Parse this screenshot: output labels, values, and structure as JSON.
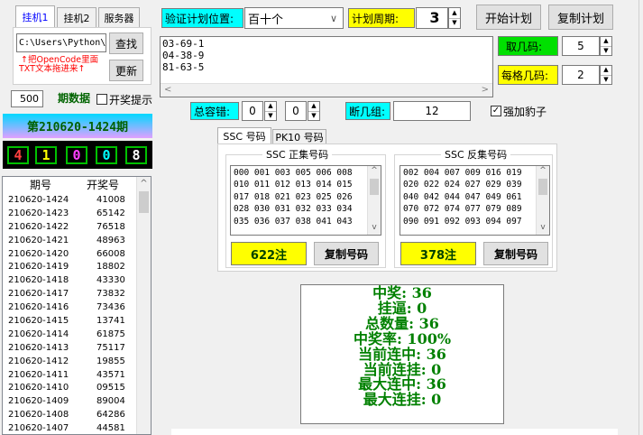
{
  "tabs": [
    {
      "label": "挂机1"
    },
    {
      "label": "挂机2"
    },
    {
      "label": "服务器"
    }
  ],
  "path_input": "C:\\Users\\Python\\D",
  "find_button": "查找",
  "hint_line1": "↑把OpenCode里面",
  "hint_line2": "TXT文本拖进来↑",
  "update_button": "更新",
  "period_count": "500",
  "period_label": "期数据",
  "lottery_hint_label": "开奖提示",
  "current_period": "第210620-1424期",
  "digits": [
    "4",
    "1",
    "0",
    "0",
    "8"
  ],
  "history": {
    "headers": [
      "期号",
      "开奖号"
    ],
    "rows": [
      [
        "210620-1424",
        "41008"
      ],
      [
        "210620-1423",
        "65142"
      ],
      [
        "210620-1422",
        "76518"
      ],
      [
        "210620-1421",
        "48963"
      ],
      [
        "210620-1420",
        "66008"
      ],
      [
        "210620-1419",
        "18802"
      ],
      [
        "210620-1418",
        "43330"
      ],
      [
        "210620-1417",
        "73832"
      ],
      [
        "210620-1416",
        "73436"
      ],
      [
        "210620-1415",
        "13741"
      ],
      [
        "210620-1414",
        "61875"
      ],
      [
        "210620-1413",
        "75117"
      ],
      [
        "210620-1412",
        "19855"
      ],
      [
        "210620-1411",
        "43571"
      ],
      [
        "210620-1410",
        "09515"
      ],
      [
        "210620-1409",
        "89004"
      ],
      [
        "210620-1408",
        "64286"
      ],
      [
        "210620-1407",
        "44581"
      ]
    ]
  },
  "verify_position_label": "验证计划位置:",
  "verify_position_value": "百十个",
  "plan_cycle_label": "计划周期:",
  "plan_cycle_value": "3",
  "start_plan_button": "开始计划",
  "copy_plan_button": "复制计划",
  "plan_lines": "03-69-1\n04-38-9\n81-63-5",
  "take_codes_label": "取几码:",
  "take_codes_value": "5",
  "every_interval_label": "每格几码:",
  "every_interval_value": "2",
  "total_tolerance_label": "总容错:",
  "tolerance_a": "0",
  "tolerance_b": "0",
  "break_groups_label": "断几组:",
  "break_groups_value": "12",
  "force_leopard_label": "强加豹子",
  "code_tabs": [
    {
      "label": "SSC 号码"
    },
    {
      "label": "PK10 号码"
    }
  ],
  "positive_title": "SSC 正集号码",
  "positive_codes": "000 001 003 005 006 008\n010 011 012 013 014 015\n017 018 021 023 025 026\n028 030 031 032 033 034\n035 036 037 038 041 043",
  "positive_count": "622注",
  "copy_codes_button": "复制号码",
  "negative_title": "SSC 反集号码",
  "negative_codes": "002 004 007 009 016 019\n020 022 024 027 029 039\n040 042 044 047 049 061\n070 072 074 077 079 089\n090 091 092 093 094 097",
  "negative_count": "378注",
  "stats": [
    "中奖: 36",
    "挂逼: 0",
    "总数量: 36",
    "中奖率: 100%",
    "当前连中: 36",
    "当前连挂: 0",
    "最大连中: 36",
    "最大连挂: 0"
  ],
  "icons": {
    "spin_up": "▲",
    "spin_down": "▼",
    "dropdown": "∨",
    "scroll_up": "^",
    "scroll_down": "v",
    "scroll_left": "<",
    "scroll_right": ">"
  }
}
